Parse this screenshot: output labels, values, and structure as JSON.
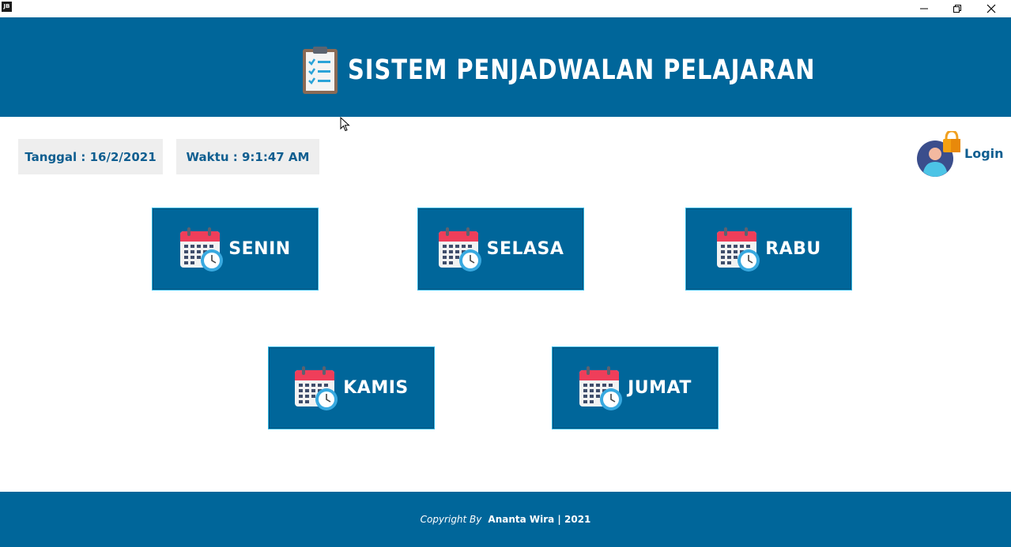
{
  "window": {
    "app_icon_text": "JB",
    "controls": [
      "minimize",
      "restore",
      "close"
    ]
  },
  "header": {
    "title": "SISTEM PENJADWALAN PELAJARAN",
    "icon": "clipboard-checklist-icon",
    "background": "#00669a"
  },
  "info": {
    "date": "Tanggal : 16/2/2021",
    "time": "Waktu : 9:1:47 AM"
  },
  "login": {
    "label": "Login",
    "icon": "user-lock-icon"
  },
  "days": [
    {
      "label": "SENIN",
      "icon": "calendar-clock-icon"
    },
    {
      "label": "SELASA",
      "icon": "calendar-clock-icon"
    },
    {
      "label": "RABU",
      "icon": "calendar-clock-icon"
    },
    {
      "label": "KAMIS",
      "icon": "calendar-clock-icon"
    },
    {
      "label": "JUMAT",
      "icon": "calendar-clock-icon"
    }
  ],
  "footer": {
    "copyright_label": "Copyright By",
    "author": "Ananta Wira | 2021"
  },
  "colors": {
    "primary": "#00669a",
    "accent_border": "#29b6e8",
    "info_box": "#eeeeee",
    "text_dark_blue": "#0f5e90"
  }
}
